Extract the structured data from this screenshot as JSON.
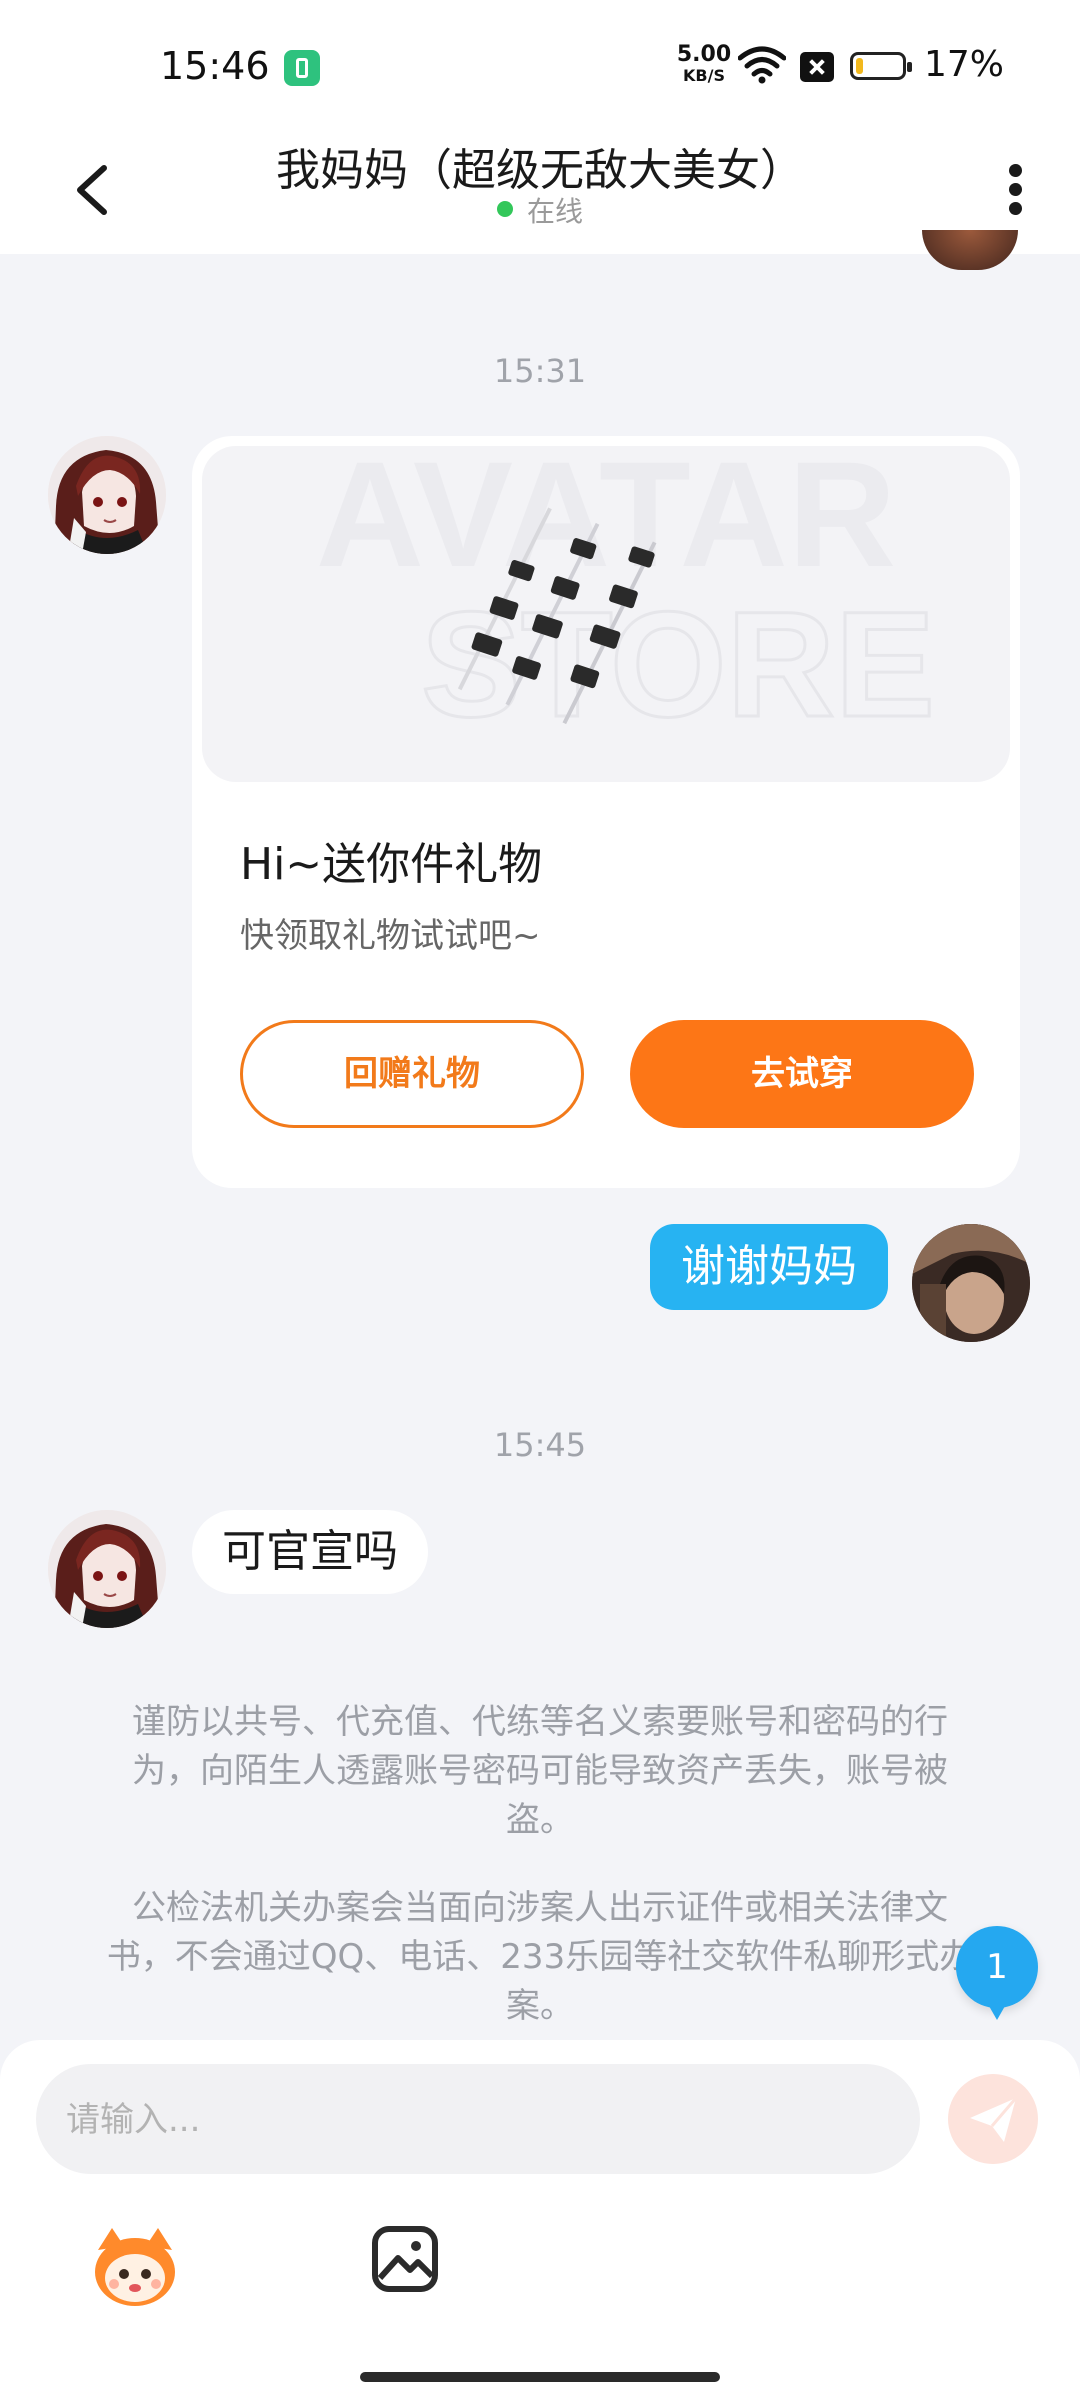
{
  "status_bar": {
    "time": "15:46",
    "net_speed_value": "5.00",
    "net_speed_unit": "KB/S",
    "battery_percent": "17%",
    "battery_level": 0.17
  },
  "header": {
    "title": "我妈妈（超级无敌大美女）",
    "presence": "在线",
    "presence_color": "#33c75a"
  },
  "messages": {
    "time_1": "15:31",
    "gift_card": {
      "image_watermark_line1": "AVATAR",
      "image_watermark_line2": "STORE",
      "title": "Hi~送你件礼物",
      "subtitle": "快领取礼物试试吧~",
      "return_gift_label": "回赠礼物",
      "try_on_label": "去试穿"
    },
    "my_reply": "谢谢妈妈",
    "time_2": "15:45",
    "mom_message": "可官宣吗"
  },
  "notices": {
    "fraud_warning": "谨防以共号、代充值、代练等名义索要账号和密码的行为，向陌生人透露账号密码可能导致资产丢失，账号被盗。",
    "police_notice": "公检法机关办案会当面向涉案人出示证件或相关法律文书，不会通过QQ、电话、233乐园等社交软件私聊形式办案。"
  },
  "unread_count": "1",
  "composer": {
    "placeholder": "请输入..."
  },
  "colors": {
    "accent_orange": "#fd7616",
    "my_bubble_blue": "#27b3f2",
    "badge_blue": "#25a8f0",
    "background": "#f3f4f8"
  },
  "icons": {
    "back": "back-arrow-icon",
    "more": "more-vertical-icon",
    "send": "send-icon",
    "emoji": "mascot-emoji-icon",
    "image": "image-picker-icon"
  }
}
